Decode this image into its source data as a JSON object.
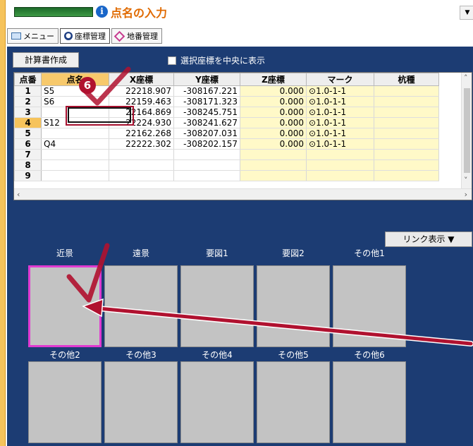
{
  "header": {
    "title": "点名の入力",
    "info_icon": "i",
    "dropdown_icon": "▼"
  },
  "tabs": [
    {
      "label": "メニュー",
      "icon": "menu-icon"
    },
    {
      "label": "座標管理",
      "icon": "coordinate-icon"
    },
    {
      "label": "地番管理",
      "icon": "lot-icon"
    }
  ],
  "toolbar": {
    "calc_button": "計算書作成",
    "center_checkbox_label": "選択座標を中央に表示"
  },
  "grid": {
    "columns": [
      "点番",
      "点名",
      "X座標",
      "Y座標",
      "Z座標",
      "マーク",
      "杭種"
    ],
    "rows": [
      {
        "no": "1",
        "name": "S5",
        "x": "22218.907",
        "y": "-308167.221",
        "z": "0.000",
        "mark": "1.0-1-1"
      },
      {
        "no": "2",
        "name": "S6",
        "x": "22159.463",
        "y": "-308171.323",
        "z": "0.000",
        "mark": "1.0-1-1"
      },
      {
        "no": "3",
        "name": "",
        "x": "22164.869",
        "y": "-308245.751",
        "z": "0.000",
        "mark": "1.0-1-1"
      },
      {
        "no": "4",
        "name": "S12",
        "x": "22224.930",
        "y": "-308241.627",
        "z": "0.000",
        "mark": "1.0-1-1"
      },
      {
        "no": "5",
        "name": "",
        "x": "22162.268",
        "y": "-308207.031",
        "z": "0.000",
        "mark": "1.0-1-1"
      },
      {
        "no": "6",
        "name": "Q4",
        "x": "22222.302",
        "y": "-308202.157",
        "z": "0.000",
        "mark": "1.0-1-1"
      },
      {
        "no": "7",
        "name": "",
        "x": "",
        "y": "",
        "z": "",
        "mark": ""
      },
      {
        "no": "8",
        "name": "",
        "x": "",
        "y": "",
        "z": "",
        "mark": ""
      },
      {
        "no": "9",
        "name": "",
        "x": "",
        "y": "",
        "z": "",
        "mark": ""
      }
    ],
    "selected_row": "4",
    "mark_symbol": "⊙"
  },
  "link_button": "リンク表示 ▼",
  "photos": {
    "row1": [
      "近景",
      "遠景",
      "要図1",
      "要図2",
      "その他1"
    ],
    "row2": [
      "その他2",
      "その他3",
      "その他4",
      "その他5",
      "その他6"
    ]
  },
  "annotation": {
    "step": "6"
  },
  "colors": {
    "accent": "#e06a00",
    "panel": "#1c3c73",
    "highlight": "#e03ad1",
    "marker": "#b0112f"
  }
}
